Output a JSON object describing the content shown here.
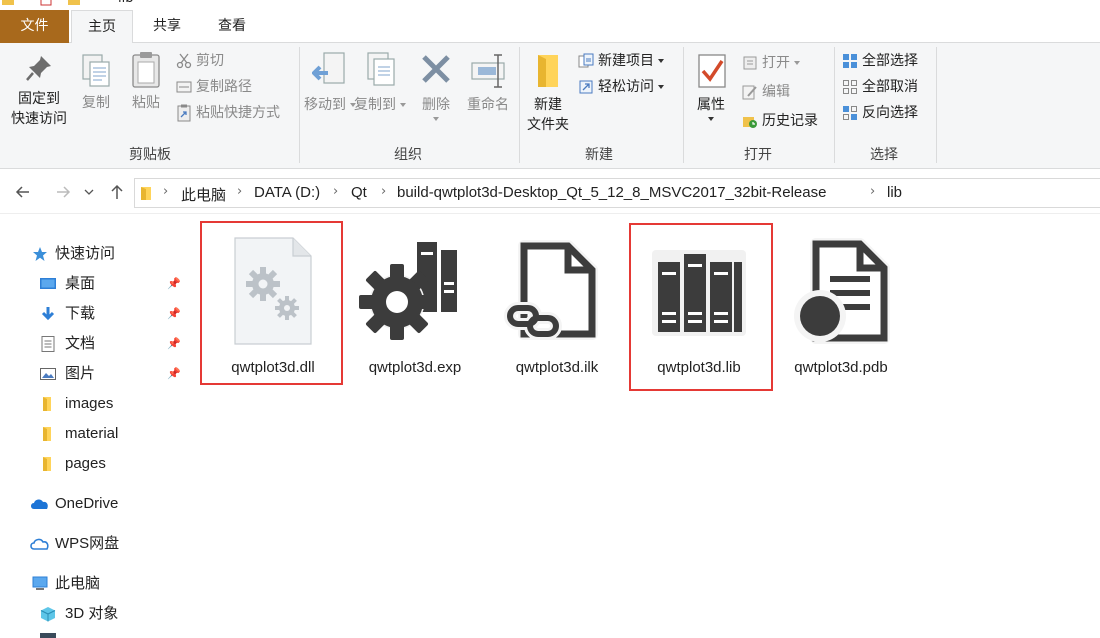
{
  "window": {
    "title": "lib"
  },
  "tabs": {
    "file": "文件",
    "home": "主页",
    "share": "共享",
    "view": "查看"
  },
  "ribbon": {
    "clipboard": {
      "label": "剪贴板",
      "pin_quick": "固定到\n快速访问",
      "pin_quick_l1": "固定到",
      "pin_quick_l2": "快速访问",
      "copy": "复制",
      "paste": "粘贴",
      "cut": "剪切",
      "copy_path": "复制路径",
      "paste_shortcut": "粘贴快捷方式"
    },
    "organize": {
      "label": "组织",
      "move_to": "移动到",
      "copy_to": "复制到",
      "delete": "删除",
      "rename": "重命名"
    },
    "new": {
      "label": "新建",
      "new_folder_l1": "新建",
      "new_folder_l2": "文件夹",
      "new_item": "新建项目",
      "easy_access": "轻松访问"
    },
    "open": {
      "label": "打开",
      "properties": "属性",
      "open": "打开",
      "edit": "编辑",
      "history": "历史记录"
    },
    "select": {
      "label": "选择",
      "select_all": "全部选择",
      "select_none": "全部取消",
      "invert": "反向选择"
    }
  },
  "address": {
    "crumbs": [
      "此电脑",
      "DATA (D:)",
      "Qt",
      "build-qwtplot3d-Desktop_Qt_5_12_8_MSVC2017_32bit-Release",
      "lib"
    ]
  },
  "navpane": {
    "quick_access": "快速访问",
    "items": [
      {
        "label": "桌面",
        "icon": "desktop-icon",
        "pinned": true
      },
      {
        "label": "下载",
        "icon": "download-icon",
        "pinned": true
      },
      {
        "label": "文档",
        "icon": "document-icon",
        "pinned": true
      },
      {
        "label": "图片",
        "icon": "picture-icon",
        "pinned": true
      },
      {
        "label": "images",
        "icon": "folder-icon",
        "pinned": false
      },
      {
        "label": "material",
        "icon": "folder-icon",
        "pinned": false
      },
      {
        "label": "pages",
        "icon": "folder-icon",
        "pinned": false
      }
    ],
    "onedrive": "OneDrive",
    "wps": "WPS网盘",
    "this_pc": "此电脑",
    "objects3d": "3D 对象"
  },
  "files": [
    {
      "name": "qwtplot3d.dll",
      "icon": "dll-gear-icon",
      "highlighted": true
    },
    {
      "name": "qwtplot3d.exp",
      "icon": "exp-gear-icon",
      "highlighted": false
    },
    {
      "name": "qwtplot3d.ilk",
      "icon": "ilk-link-icon",
      "highlighted": false
    },
    {
      "name": "qwtplot3d.lib",
      "icon": "lib-books-icon",
      "highlighted": true
    },
    {
      "name": "qwtplot3d.pdb",
      "icon": "pdb-doc-icon",
      "highlighted": false
    }
  ],
  "colors": {
    "file_tab": "#a8691c",
    "highlight": "#e53935",
    "ribbon_bg": "#f5f6f7",
    "icon_dark": "#3c3c3c"
  }
}
